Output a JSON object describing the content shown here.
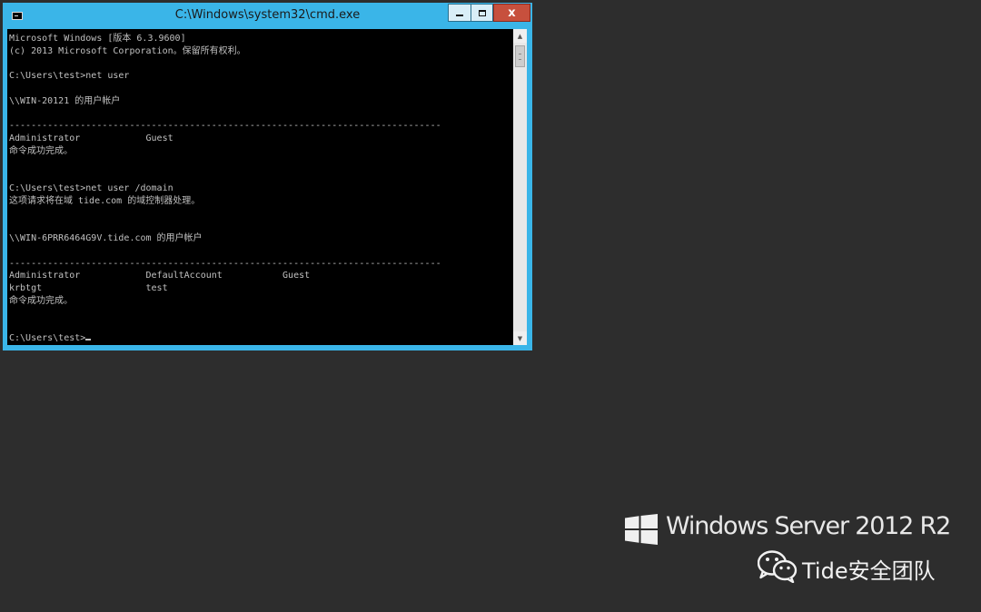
{
  "window": {
    "title": "C:\\Windows\\system32\\cmd.exe",
    "close_glyph": "x"
  },
  "console": {
    "lines": [
      "Microsoft Windows [版本 6.3.9600]",
      "(c) 2013 Microsoft Corporation。保留所有权利。",
      "",
      "C:\\Users\\test>net user",
      "",
      "\\\\WIN-20121 的用户帐户",
      "",
      "-------------------------------------------------------------------------------",
      "Administrator            Guest",
      "命令成功完成。",
      "",
      "",
      "C:\\Users\\test>net user /domain",
      "这项请求将在域 tide.com 的域控制器处理。",
      "",
      "",
      "\\\\WIN-6PRR6464G9V.tide.com 的用户帐户",
      "",
      "-------------------------------------------------------------------------------",
      "Administrator            DefaultAccount           Guest",
      "krbtgt                   test",
      "命令成功完成。",
      "",
      "",
      "C:\\Users\\test>"
    ]
  },
  "branding": {
    "os_name": "Windows Server 2012 R2",
    "watermark": "Tide安全团队"
  },
  "colors": {
    "desktop_bg": "#2d2d2d",
    "window_frame": "#3ab5e8",
    "console_bg": "#000000",
    "console_text": "#c0c0c0",
    "close_button": "#c7503d"
  },
  "icons": {
    "app": "cmd-icon",
    "minimize": "minimize-icon",
    "maximize": "maximize-icon",
    "close": "close-icon",
    "scroll_up": "scroll-up-arrow-icon",
    "scroll_down": "scroll-down-arrow-icon",
    "os_logo": "windows-logo-icon",
    "watermark_logo": "wechat-icon"
  }
}
